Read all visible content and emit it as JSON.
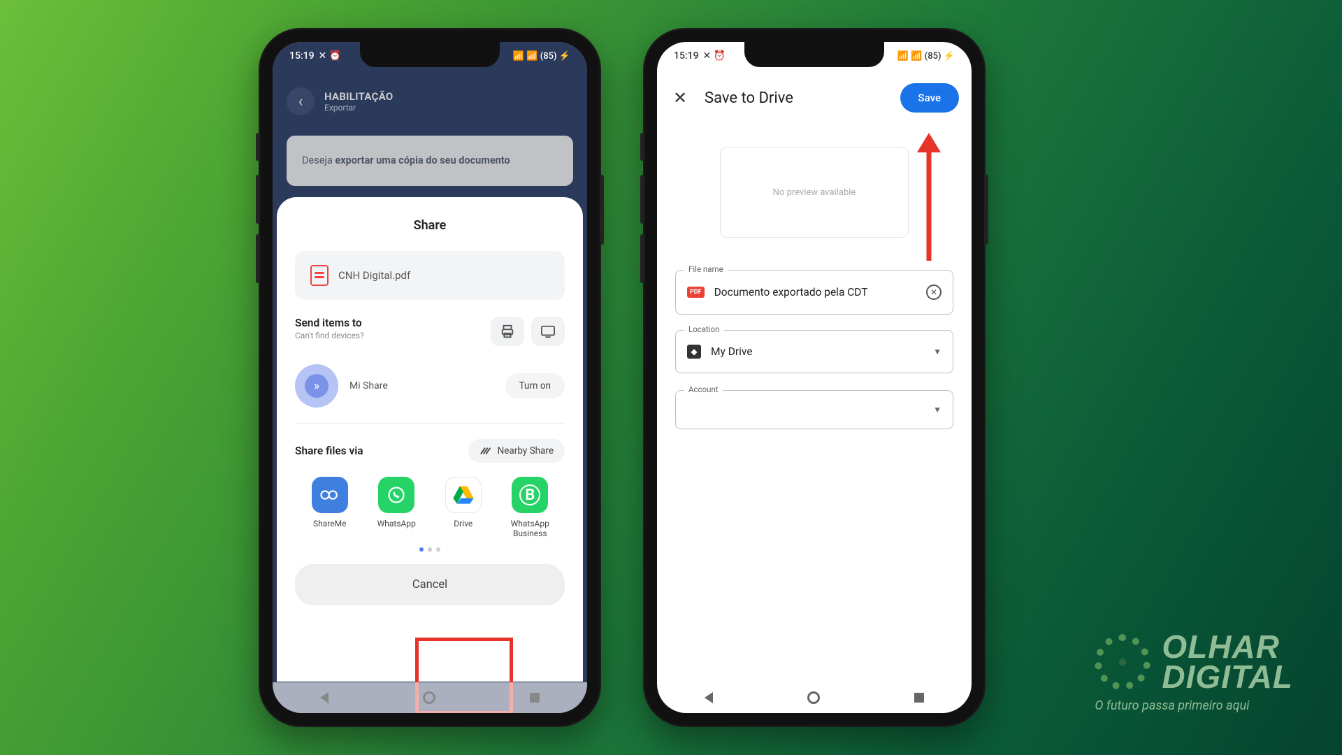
{
  "status": {
    "time": "15:19",
    "icons_left": "✕ ⏰",
    "icons_right": "📶 📶 (85) ⚡"
  },
  "phone1": {
    "header_title": "HABILITAÇÃO",
    "header_subtitle": "Exportar",
    "banner_prefix": "Deseja ",
    "banner_bold": "exportar uma cópia do seu documento",
    "share_title": "Share",
    "file_name": "CNH Digital.pdf",
    "send_label": "Send items to",
    "send_hint": "Can't find devices?",
    "mi_share": "Mi Share",
    "turn_on": "Turn on",
    "share_via": "Share files via",
    "nearby": "Nearby Share",
    "apps": {
      "shareme": "ShareMe",
      "whatsapp": "WhatsApp",
      "drive": "Drive",
      "wab": "WhatsApp Business"
    },
    "cancel": "Cancel"
  },
  "phone2": {
    "title": "Save to Drive",
    "save": "Save",
    "no_preview": "No preview available",
    "filename_label": "File name",
    "filename_value": "Documento exportado pela CDT",
    "location_label": "Location",
    "location_value": "My Drive",
    "account_label": "Account",
    "account_value": ""
  },
  "watermark": {
    "line1": "OLHAR",
    "line2": "DIGITAL",
    "tagline": "O futuro passa primeiro aqui"
  }
}
